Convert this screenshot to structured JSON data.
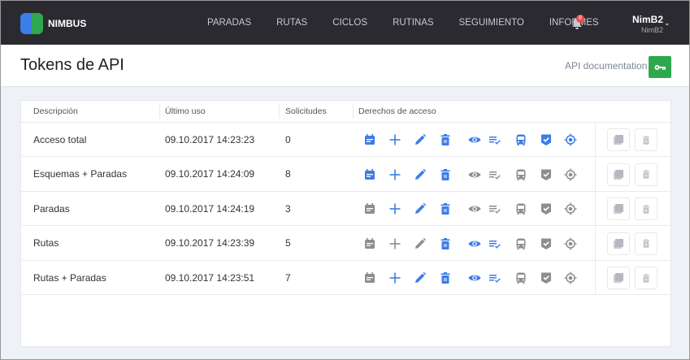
{
  "colors": {
    "on": "#3b7de9",
    "off": "#8d8d92",
    "green": "#2ea84e"
  },
  "nav": {
    "brand": "NIMBUS",
    "items": [
      "PARADAS",
      "RUTAS",
      "CICLOS",
      "RUTINAS",
      "SEGUIMIENTO",
      "INFORMES"
    ],
    "notifications": "8",
    "user_name": "NimB2",
    "user_sub": "NimB2"
  },
  "header": {
    "title": "Tokens de API",
    "doc_link": "API documentation"
  },
  "table": {
    "columns": [
      "Descripción",
      "Último uso",
      "Solicitudes",
      "Derechos de acceso"
    ],
    "permission_icons": [
      "calendar-icon",
      "plus-icon",
      "pencil-icon",
      "trash-icon",
      "eye-icon",
      "list-check-icon",
      "bus-icon",
      "shield-check-icon",
      "target-icon"
    ],
    "rows": [
      {
        "description": "Acceso total",
        "last_used": "09.10.2017 14:23:23",
        "requests": "0",
        "rights": [
          1,
          1,
          1,
          1,
          1,
          1,
          1,
          1,
          1
        ]
      },
      {
        "description": "Esquemas + Paradas",
        "last_used": "09.10.2017 14:24:09",
        "requests": "8",
        "rights": [
          1,
          1,
          1,
          1,
          0,
          0,
          0,
          0,
          0
        ]
      },
      {
        "description": "Paradas",
        "last_used": "09.10.2017 14:24:19",
        "requests": "3",
        "rights": [
          0,
          1,
          1,
          1,
          0,
          0,
          0,
          0,
          0
        ]
      },
      {
        "description": "Rutas",
        "last_used": "09.10.2017 14:23:39",
        "requests": "5",
        "rights": [
          0,
          0,
          0,
          1,
          1,
          1,
          0,
          0,
          0
        ]
      },
      {
        "description": "Rutas + Paradas",
        "last_used": "09.10.2017 14:23:51",
        "requests": "7",
        "rights": [
          0,
          1,
          1,
          1,
          1,
          1,
          0,
          0,
          0
        ]
      }
    ]
  }
}
